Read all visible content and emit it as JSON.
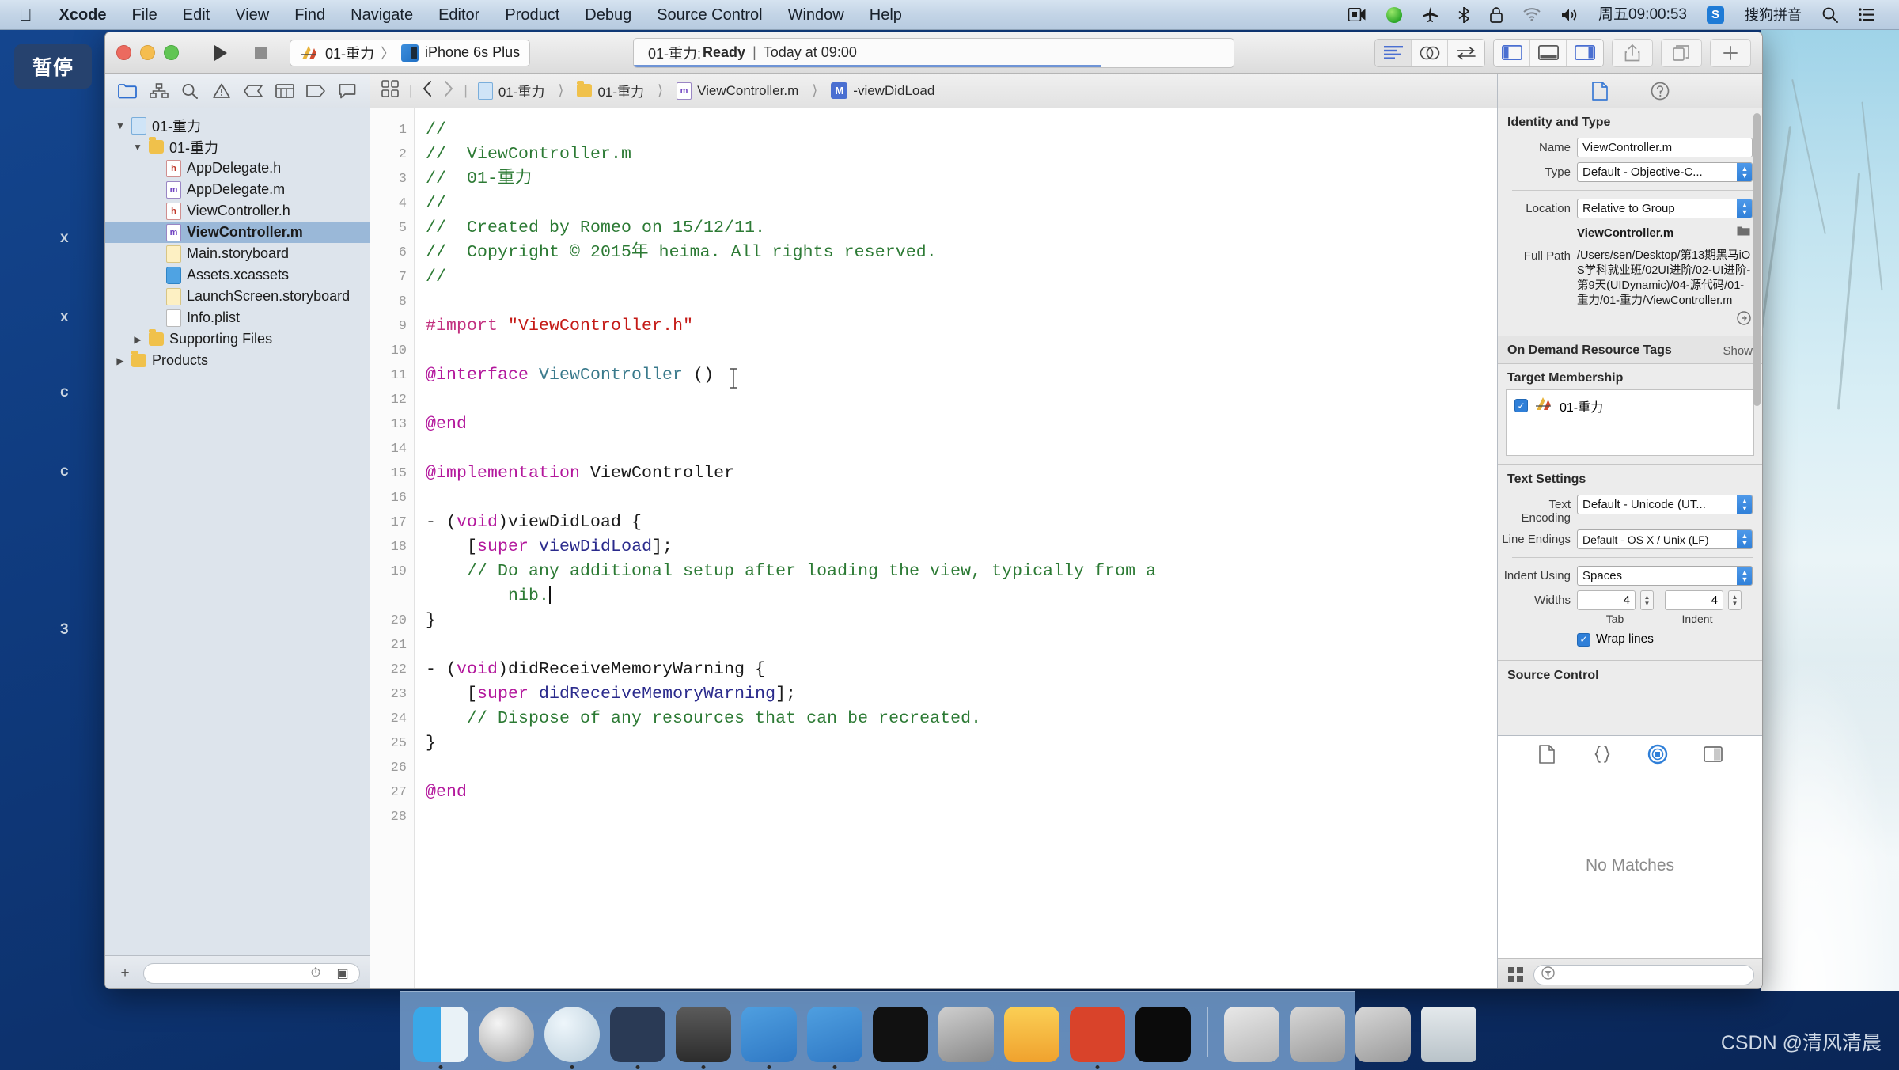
{
  "menubar": {
    "apple": "apple-logo",
    "items": [
      {
        "label": "Xcode",
        "bold": true
      },
      {
        "label": "File",
        "bold": false
      },
      {
        "label": "Edit",
        "bold": false
      },
      {
        "label": "View",
        "bold": false
      },
      {
        "label": "Find",
        "bold": false
      },
      {
        "label": "Navigate",
        "bold": false
      },
      {
        "label": "Editor",
        "bold": false
      },
      {
        "label": "Product",
        "bold": false
      },
      {
        "label": "Debug",
        "bold": false
      },
      {
        "label": "Source Control",
        "bold": false
      },
      {
        "label": "Window",
        "bold": false
      },
      {
        "label": "Help",
        "bold": false
      }
    ],
    "status_icons": [
      "screen-record-icon",
      "quicktime-green-icon",
      "airplane-icon",
      "bluetooth-icon",
      "lock-icon",
      "wifi-icon",
      "volume-icon"
    ],
    "clock": "周五09:00:53",
    "input_method": "搜狗拼音",
    "input_badge": "S",
    "search_icon": "spotlight-search-icon",
    "list_icon": "notification-center-icon"
  },
  "overlay": {
    "pause_label": "暂停"
  },
  "background_letters": [
    "x",
    "x",
    "c",
    "c",
    "3"
  ],
  "window": {
    "toolbar": {
      "run_icon": "run-play-icon",
      "stop_icon": "stop-square-icon",
      "scheme_project": "01-重力",
      "scheme_separator": "〉",
      "scheme_destination": "iPhone 6s Plus",
      "status_project": "01-重力:",
      "status_state": "Ready",
      "status_divider": "|",
      "status_time": "Today at 09:00",
      "editor_modes": [
        "standard-editor-icon",
        "assistant-editor-icon",
        "version-editor-icon"
      ],
      "view_toggles": [
        "navigator-toggle-icon",
        "debug-area-toggle-icon",
        "utilities-toggle-icon"
      ],
      "share_icon": "share-icon",
      "organizer_icon": "window-organizer-icon",
      "plus_icon": "add-icon"
    },
    "navigator": {
      "tabs": [
        "project-navigator-icon",
        "symbol-navigator-icon",
        "find-navigator-icon",
        "issue-navigator-icon",
        "test-navigator-icon",
        "debug-navigator-icon",
        "breakpoint-navigator-icon",
        "report-navigator-icon"
      ],
      "tree": [
        {
          "label": "01-重力",
          "depth": 0,
          "icon": "project",
          "disclosure": "open",
          "selected": false
        },
        {
          "label": "01-重力",
          "depth": 1,
          "icon": "folder",
          "disclosure": "open",
          "selected": false
        },
        {
          "label": "AppDelegate.h",
          "depth": 2,
          "icon": "hfile",
          "disclosure": "none",
          "selected": false
        },
        {
          "label": "AppDelegate.m",
          "depth": 2,
          "icon": "mfile",
          "disclosure": "none",
          "selected": false
        },
        {
          "label": "ViewController.h",
          "depth": 2,
          "icon": "hfile",
          "disclosure": "none",
          "selected": false
        },
        {
          "label": "ViewController.m",
          "depth": 2,
          "icon": "mfile",
          "disclosure": "none",
          "selected": true
        },
        {
          "label": "Main.storyboard",
          "depth": 2,
          "icon": "sb",
          "disclosure": "none",
          "selected": false
        },
        {
          "label": "Assets.xcassets",
          "depth": 2,
          "icon": "xc",
          "disclosure": "none",
          "selected": false
        },
        {
          "label": "LaunchScreen.storyboard",
          "depth": 2,
          "icon": "sb",
          "disclosure": "none",
          "selected": false
        },
        {
          "label": "Info.plist",
          "depth": 2,
          "icon": "doc",
          "disclosure": "none",
          "selected": false
        },
        {
          "label": "Supporting Files",
          "depth": 1,
          "icon": "folder",
          "disclosure": "closed",
          "selected": false
        },
        {
          "label": "Products",
          "depth": 0,
          "icon": "folder",
          "disclosure": "closed",
          "selected": false
        }
      ],
      "footer": {
        "add_icon": "add-file-icon",
        "filter_icon": "filter-circle-icon",
        "filter_placeholder": "",
        "recent_icon": "recent-files-icon",
        "source_control_icon": "source-control-filter-icon"
      }
    },
    "editor": {
      "related_items_icon": "related-items-grid-icon",
      "back_icon": "back-chevron-icon",
      "forward_icon": "forward-chevron-icon",
      "breadcrumbs": [
        {
          "label": "01-重力",
          "icon": "project"
        },
        {
          "label": "01-重力",
          "icon": "folder"
        },
        {
          "label": "ViewController.m",
          "icon": "mfile"
        },
        {
          "label": "-viewDidLoad",
          "icon": "method"
        }
      ],
      "line_count": 28,
      "lines": [
        {
          "n": 1,
          "tokens": [
            {
              "t": "//",
              "c": "cmt"
            }
          ]
        },
        {
          "n": 2,
          "tokens": [
            {
              "t": "//  ViewController.m",
              "c": "cmt"
            }
          ]
        },
        {
          "n": 3,
          "tokens": [
            {
              "t": "//  01-重力",
              "c": "cmt"
            }
          ]
        },
        {
          "n": 4,
          "tokens": [
            {
              "t": "//",
              "c": "cmt"
            }
          ]
        },
        {
          "n": 5,
          "tokens": [
            {
              "t": "//  Created by Romeo on 15/12/11.",
              "c": "cmt"
            }
          ]
        },
        {
          "n": 6,
          "tokens": [
            {
              "t": "//  Copyright © 2015年 heima. All rights reserved.",
              "c": "cmt"
            }
          ]
        },
        {
          "n": 7,
          "tokens": [
            {
              "t": "//",
              "c": "cmt"
            }
          ]
        },
        {
          "n": 8,
          "tokens": []
        },
        {
          "n": 9,
          "tokens": [
            {
              "t": "#import ",
              "c": "pre"
            },
            {
              "t": "\"ViewController.h\"",
              "c": "str"
            }
          ]
        },
        {
          "n": 10,
          "tokens": []
        },
        {
          "n": 11,
          "tokens": [
            {
              "t": "@interface ",
              "c": "kw"
            },
            {
              "t": "ViewController",
              "c": "typ"
            },
            {
              "t": " ()",
              "c": "pln"
            }
          ]
        },
        {
          "n": 12,
          "tokens": []
        },
        {
          "n": 13,
          "tokens": [
            {
              "t": "@end",
              "c": "kw"
            }
          ]
        },
        {
          "n": 14,
          "tokens": []
        },
        {
          "n": 15,
          "tokens": [
            {
              "t": "@implementation ",
              "c": "kw"
            },
            {
              "t": "ViewController",
              "c": "pln"
            }
          ]
        },
        {
          "n": 16,
          "tokens": []
        },
        {
          "n": 17,
          "tokens": [
            {
              "t": "- (",
              "c": "pln"
            },
            {
              "t": "void",
              "c": "kw"
            },
            {
              "t": ")viewDidLoad {",
              "c": "pln"
            }
          ]
        },
        {
          "n": 18,
          "tokens": [
            {
              "t": "    [",
              "c": "pln"
            },
            {
              "t": "super",
              "c": "kw"
            },
            {
              "t": " ",
              "c": "pln"
            },
            {
              "t": "viewDidLoad",
              "c": "fn"
            },
            {
              "t": "];",
              "c": "pln"
            }
          ]
        },
        {
          "n": 19,
          "tokens": [
            {
              "t": "    // Do any additional setup after loading the view, typically from a",
              "c": "cmt"
            }
          ]
        },
        {
          "n": "",
          "tokens": [
            {
              "t": "        nib.",
              "c": "cmt"
            }
          ],
          "caret": true
        },
        {
          "n": 20,
          "tokens": [
            {
              "t": "}",
              "c": "pln"
            }
          ]
        },
        {
          "n": 21,
          "tokens": []
        },
        {
          "n": 22,
          "tokens": [
            {
              "t": "- (",
              "c": "pln"
            },
            {
              "t": "void",
              "c": "kw"
            },
            {
              "t": ")didReceiveMemoryWarning {",
              "c": "pln"
            }
          ]
        },
        {
          "n": 23,
          "tokens": [
            {
              "t": "    [",
              "c": "pln"
            },
            {
              "t": "super",
              "c": "kw"
            },
            {
              "t": " ",
              "c": "pln"
            },
            {
              "t": "didReceiveMemoryWarning",
              "c": "fn"
            },
            {
              "t": "];",
              "c": "pln"
            }
          ]
        },
        {
          "n": 24,
          "tokens": [
            {
              "t": "    // Dispose of any resources that can be recreated.",
              "c": "cmt"
            }
          ]
        },
        {
          "n": 25,
          "tokens": [
            {
              "t": "}",
              "c": "pln"
            }
          ]
        },
        {
          "n": 26,
          "tokens": []
        },
        {
          "n": 27,
          "tokens": [
            {
              "t": "@end",
              "c": "kw"
            }
          ]
        },
        {
          "n": 28,
          "tokens": []
        }
      ]
    },
    "inspector": {
      "tabs": [
        "file-inspector-icon",
        "quick-help-inspector-icon"
      ],
      "identity_and_type": {
        "title": "Identity and Type",
        "name_label": "Name",
        "name_value": "ViewController.m",
        "type_label": "Type",
        "type_value": "Default - Objective-C...",
        "location_label": "Location",
        "location_value": "Relative to Group",
        "file_name": "ViewController.m",
        "choose_icon": "choose-folder-icon",
        "full_path_label": "Full Path",
        "full_path_value": "/Users/sen/Desktop/第13期黑马iOS学科就业班/02UI进阶/02-UI进阶-第9天(UIDynamic)/04-源代码/01-重力/01-重力/ViewController.m",
        "reveal_icon": "reveal-in-finder-icon"
      },
      "on_demand": {
        "title": "On Demand Resource Tags",
        "show_label": "Show"
      },
      "target_membership": {
        "title": "Target Membership",
        "rows": [
          {
            "checked": true,
            "label": "01-重力"
          }
        ]
      },
      "text_settings": {
        "title": "Text Settings",
        "encoding_label": "Text Encoding",
        "encoding_value": "Default - Unicode (UT...",
        "line_endings_label": "Line Endings",
        "line_endings_value": "Default - OS X / Unix (LF)",
        "indent_label": "Indent Using",
        "indent_value": "Spaces",
        "widths_label": "Widths",
        "tab_value": "4",
        "indent_value_num": "4",
        "tab_sublabel": "Tab",
        "indent_sublabel": "Indent",
        "wrap_label": "Wrap lines",
        "wrap_checked": true
      },
      "source_control": {
        "title": "Source Control"
      }
    },
    "library": {
      "tabs": [
        "file-template-library-icon",
        "code-snippet-library-icon",
        "object-library-icon",
        "media-library-icon"
      ],
      "selected_tab_index": 2,
      "empty_message": "No Matches",
      "footer": {
        "layout_icon": "library-layout-icon",
        "filter_icon": "filter-circle-icon",
        "filter_placeholder": ""
      }
    }
  },
  "dock": {
    "items": [
      {
        "name": "finder",
        "running": true
      },
      {
        "name": "launchpad",
        "running": false
      },
      {
        "name": "safari",
        "running": true
      },
      {
        "name": "mouse-app",
        "running": true
      },
      {
        "name": "quicktime-player",
        "running": true
      },
      {
        "name": "xcode",
        "running": true
      },
      {
        "name": "simulator",
        "running": true
      },
      {
        "name": "terminal",
        "running": false
      },
      {
        "name": "system-preferences",
        "running": false
      },
      {
        "name": "sketch",
        "running": false
      },
      {
        "name": "prepros",
        "running": true
      },
      {
        "name": "exec-tool",
        "running": false
      },
      {
        "name": "separator",
        "running": false
      },
      {
        "name": "media-player",
        "running": false
      },
      {
        "name": "screen-sharing-1",
        "running": false
      },
      {
        "name": "screen-sharing-2",
        "running": false
      },
      {
        "name": "trash",
        "running": false
      }
    ]
  },
  "watermark": "CSDN @清风清晨"
}
